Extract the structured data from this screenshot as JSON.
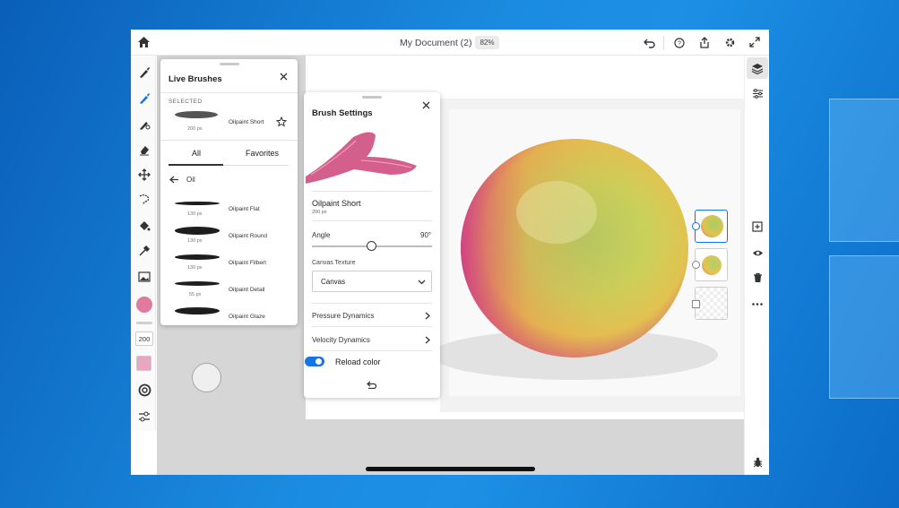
{
  "header": {
    "doc_title": "My Document (2)",
    "zoom": "82%",
    "icons": [
      "home-icon",
      "undo-icon",
      "help-icon",
      "share-icon",
      "settings-icon",
      "fullscreen-icon"
    ]
  },
  "toolbar": {
    "tools": [
      "pixel-brush-icon",
      "live-brush-icon",
      "vector-brush-icon",
      "eraser-icon",
      "move-icon",
      "selection-icon",
      "fill-icon",
      "eyedropper-icon",
      "image-icon"
    ],
    "color": "#e07aa0",
    "size_value": "200",
    "swatch_color": "#e8a6c0"
  },
  "live_brushes": {
    "title": "Live Brushes",
    "selected_label": "SELECTED",
    "selected_brush": {
      "name": "Oilpaint Short",
      "px": "200 px"
    },
    "tabs": [
      "All",
      "Favorites"
    ],
    "category": "Oil",
    "brushes": [
      {
        "name": "Oilpaint Flat",
        "px": "130 px"
      },
      {
        "name": "Oilpaint Round",
        "px": "130 px"
      },
      {
        "name": "Oilpaint Filbert",
        "px": "130 px"
      },
      {
        "name": "Oilpaint Detail",
        "px": "55 px"
      },
      {
        "name": "Oilpaint Glaze",
        "px": ""
      }
    ]
  },
  "brush_settings": {
    "title": "Brush Settings",
    "brush_name": "Oilpaint Short",
    "brush_px": "200 px",
    "angle_label": "Angle",
    "angle_value": "90°",
    "angle_fraction": 0.5,
    "texture_label": "Canvas Texture",
    "texture_value": "Canvas",
    "pressure_label": "Pressure Dynamics",
    "velocity_label": "Velocity Dynamics",
    "reload_label": "Reload color",
    "reload_on": true,
    "accent": "#1473e6",
    "stroke_color": "#d45f8c"
  },
  "right_panel": {
    "icons": [
      "layers-icon",
      "adjustments-icon",
      "add-layer-icon",
      "visibility-icon",
      "delete-icon",
      "more-icon",
      "bug-icon"
    ],
    "layers": [
      "layer-1",
      "layer-2",
      "layer-3"
    ]
  }
}
